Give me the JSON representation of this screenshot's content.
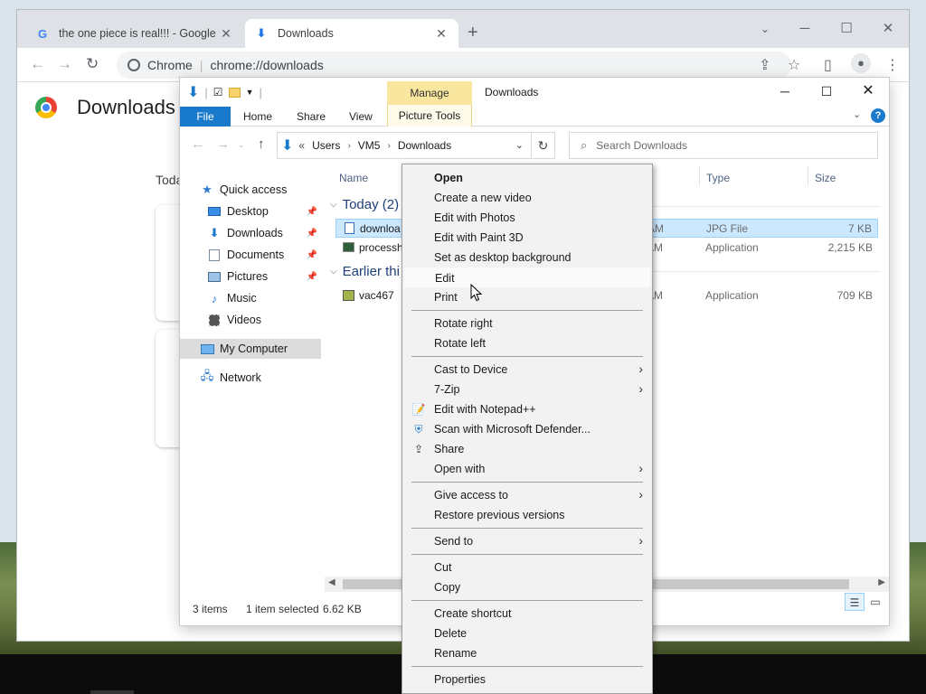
{
  "chrome": {
    "tabs": [
      {
        "title": "the one piece is real!!! - Google S",
        "favicon": "google-g-icon"
      },
      {
        "title": "Downloads",
        "favicon": "download-icon"
      }
    ],
    "omnibox_site": "Chrome",
    "omnibox_url": "chrome://downloads",
    "page_title": "Downloads",
    "section_label": "Toda"
  },
  "explorer": {
    "window_title": "Downloads",
    "contextual_tab_group": "Manage",
    "ribbon_tabs": [
      "File",
      "Home",
      "Share",
      "View",
      "Picture Tools"
    ],
    "breadcrumb": [
      "Users",
      "VM5",
      "Downloads"
    ],
    "breadcrumb_overflow": "«",
    "search_placeholder": "Search Downloads",
    "nav": [
      {
        "label": "Quick access",
        "icon": "star-icon",
        "pinned": false
      },
      {
        "label": "Desktop",
        "icon": "desktop-folder-icon",
        "pinned": true
      },
      {
        "label": "Downloads",
        "icon": "download-arrow-icon",
        "pinned": true
      },
      {
        "label": "Documents",
        "icon": "documents-icon",
        "pinned": true
      },
      {
        "label": "Pictures",
        "icon": "pictures-icon",
        "pinned": true
      },
      {
        "label": "Music",
        "icon": "music-note-icon",
        "pinned": false
      },
      {
        "label": "Videos",
        "icon": "film-icon",
        "pinned": false
      },
      {
        "label": "My Computer",
        "icon": "computer-icon",
        "pinned": false
      },
      {
        "label": "Network",
        "icon": "network-icon",
        "pinned": false
      }
    ],
    "columns": {
      "name": "Name",
      "type": "Type",
      "size": "Size"
    },
    "groups": [
      {
        "label": "Today (2)"
      },
      {
        "label": "Earlier thi"
      }
    ],
    "files": [
      {
        "name": "downloa",
        "date": "AM",
        "type": "JPG File",
        "size": "7 KB",
        "icon": "image-file-icon"
      },
      {
        "name": "processh",
        "date": "AM",
        "type": "Application",
        "size": "2,215 KB",
        "icon": "app-exe-icon"
      },
      {
        "name": "vac467",
        "date": "AM",
        "type": "Application",
        "size": "709 KB",
        "icon": "app-exe-icon"
      }
    ],
    "status": {
      "items": "3 items",
      "selected": "1 item selected",
      "size": "6.62 KB"
    }
  },
  "context_menu": [
    {
      "label": "Open",
      "bold": true
    },
    {
      "label": "Create a new video"
    },
    {
      "label": "Edit with Photos"
    },
    {
      "label": "Edit with Paint 3D"
    },
    {
      "label": "Set as desktop background"
    },
    {
      "label": "Edit",
      "hover": true
    },
    {
      "label": "Print"
    },
    {
      "separator": true
    },
    {
      "label": "Rotate right"
    },
    {
      "label": "Rotate left"
    },
    {
      "separator": true
    },
    {
      "label": "Cast to Device",
      "submenu": true
    },
    {
      "label": "7-Zip",
      "submenu": true
    },
    {
      "label": "Edit with Notepad++",
      "icon": "notepad-plus-plus-icon"
    },
    {
      "label": "Scan with Microsoft Defender...",
      "icon": "defender-shield-icon"
    },
    {
      "label": "Share",
      "icon": "share-icon"
    },
    {
      "label": "Open with",
      "submenu": true
    },
    {
      "separator": true
    },
    {
      "label": "Give access to",
      "submenu": true
    },
    {
      "label": "Restore previous versions"
    },
    {
      "separator": true
    },
    {
      "label": "Send to",
      "submenu": true
    },
    {
      "separator": true
    },
    {
      "label": "Cut"
    },
    {
      "label": "Copy"
    },
    {
      "separator": true
    },
    {
      "label": "Create shortcut"
    },
    {
      "label": "Delete"
    },
    {
      "label": "Rename"
    },
    {
      "separator": true
    },
    {
      "label": "Properties"
    }
  ],
  "colors": {
    "accent": "#1979ca",
    "selection": "#cce8ff",
    "manage_tab": "#f9e79f"
  }
}
